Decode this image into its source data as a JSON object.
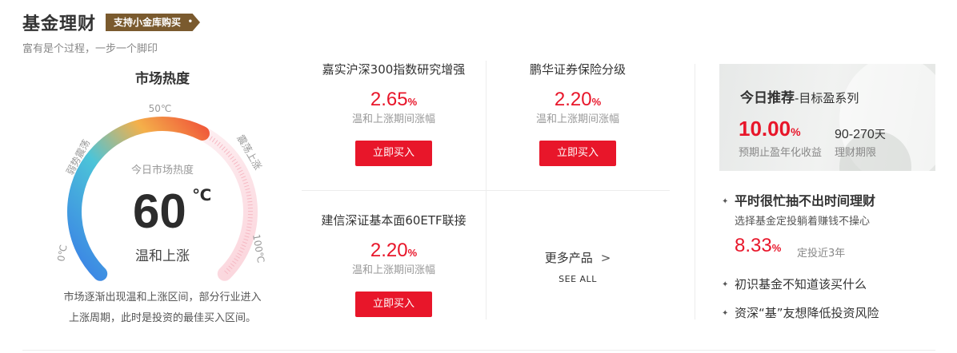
{
  "header": {
    "title": "基金理财",
    "tag": "支持小金库购买",
    "tag_dot": "•",
    "subtitle": "富有是个过程，一步一个脚印"
  },
  "gauge": {
    "title": "市场热度",
    "caption": "今日市场热度",
    "value": 60,
    "value_text": "60",
    "unit": "℃",
    "state": "温和上涨",
    "scale_min": "0℃",
    "scale_mid": "50℃",
    "scale_max": "100℃",
    "zone_left": "弱势震荡",
    "zone_right": "震荡上涨",
    "description_line1": "市场逐渐出现温和上涨区间，部分行业进入",
    "description_line2": "上涨周期，此时是投资的最佳买入区间。",
    "colors": {
      "low": "#3a8ee8",
      "mid": "#4cc4d8",
      "warm": "#f2a24a",
      "high": "#f05a3a",
      "track": "#fde7ea"
    }
  },
  "funds": [
    {
      "name": "嘉实沪深300指数研究增强",
      "rate": "2.65",
      "rate_unit": "%",
      "rate_label": "温和上涨期间涨幅",
      "button": "立即买入"
    },
    {
      "name": "鹏华证券保险分级",
      "rate": "2.20",
      "rate_unit": "%",
      "rate_label": "温和上涨期间涨幅",
      "button": "立即买入"
    },
    {
      "name": "建信深证基本面60ETF联接",
      "rate": "2.20",
      "rate_unit": "%",
      "rate_label": "温和上涨期间涨幅",
      "button": "立即买入"
    }
  ],
  "more": {
    "label": "更多产品",
    "arrow": ">",
    "sub": "SEE ALL"
  },
  "promo": {
    "title_bold": "今日推荐",
    "title_rest": "-目标盈系列",
    "rate": "10.00",
    "rate_unit": "%",
    "rate_label": "预期止盈年化收益",
    "term": "90-270",
    "term_unit": "天",
    "term_label": "理财期限"
  },
  "tips": {
    "main": "平时很忙抽不出时间理财",
    "sub": "选择基金定投躺着赚钱不操心",
    "rate": "8.33",
    "rate_unit": "%",
    "rate_label": "定投近3年",
    "item2": "初识基金不知道该买什么",
    "item3": "资深“基”友想降低投资风险",
    "bullet": "✦"
  },
  "colors": {
    "accent": "#e8162a",
    "tag_bg": "#7a5a2e"
  }
}
